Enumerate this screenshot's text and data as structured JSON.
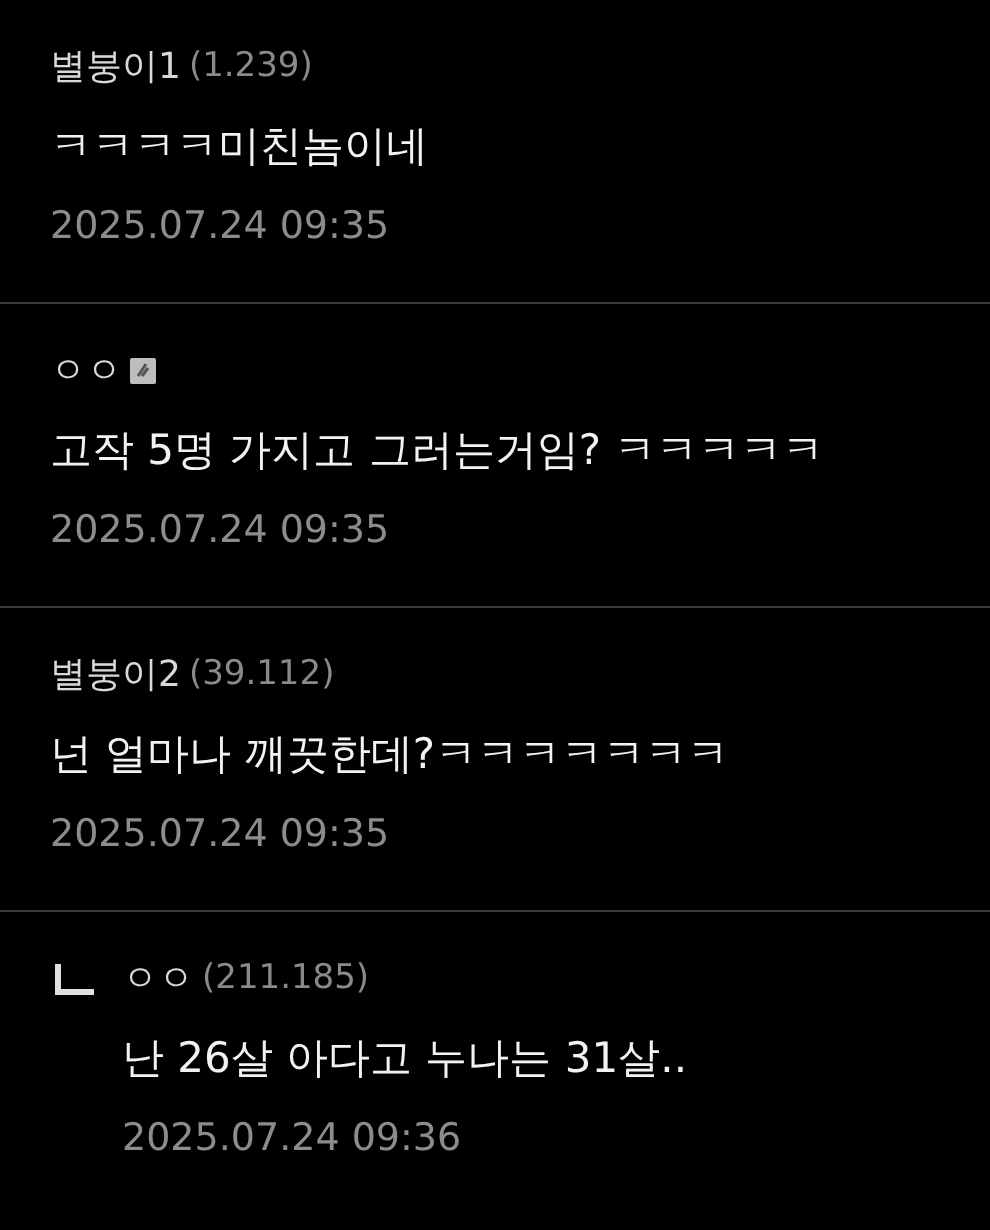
{
  "comments": [
    {
      "kind": "comment",
      "author": "별붕이1",
      "ip": "(1.239)",
      "member": false,
      "text": "ㅋㅋㅋㅋ미친놈이네",
      "date": "2025.07.24 09:35"
    },
    {
      "kind": "comment",
      "author": "ㅇㅇ",
      "member": true,
      "text": "고작 5명 가지고 그러는거임? ㅋㅋㅋㅋㅋ",
      "date": "2025.07.24 09:35"
    },
    {
      "kind": "comment",
      "author": "별붕이2",
      "ip": "(39.112)",
      "member": false,
      "text": "넌 얼마나 깨끗한데?ㅋㅋㅋㅋㅋㅋㅋ",
      "date": "2025.07.24 09:35"
    },
    {
      "kind": "reply",
      "author": "ㅇㅇ",
      "ip": "(211.185)",
      "member": false,
      "text": "난 26살 아다고 누나는 31살..",
      "date": "2025.07.24 09:36"
    }
  ]
}
